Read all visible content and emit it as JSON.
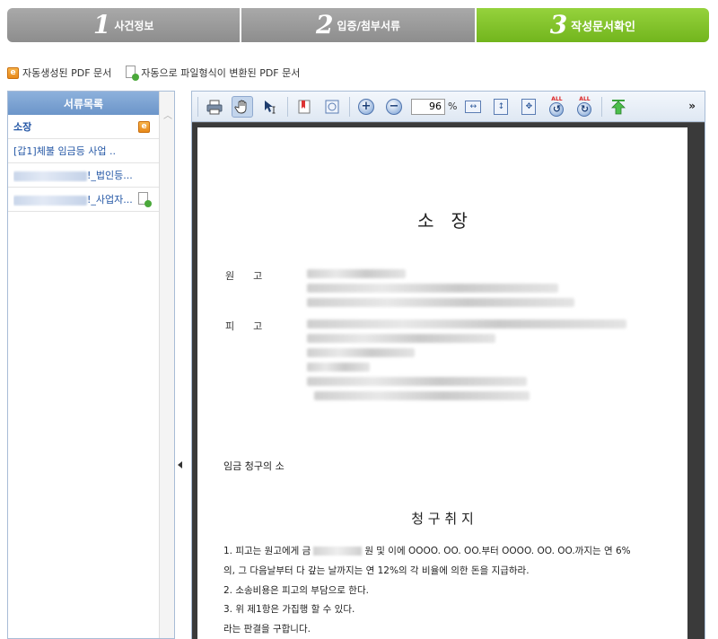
{
  "steps": [
    {
      "num": "1",
      "label": "사건정보"
    },
    {
      "num": "2",
      "label": "입증/첨부서류"
    },
    {
      "num": "3",
      "label": "작성문서확인"
    }
  ],
  "legend": {
    "auto_label": "자동생성된 PDF 문서",
    "converted_label": "자동으로 파일형식이 변환된 PDF 문서"
  },
  "doc_list": {
    "header": "서류목록",
    "items": [
      {
        "label": "소장",
        "icon": "auto-pdf-icon",
        "active": true
      },
      {
        "label": "[갑1]체불 임금등 사업 ..",
        "icon": null
      },
      {
        "label": "!_법인등...",
        "icon": null,
        "blurred_prefix": true
      },
      {
        "label": "!_사업자...",
        "icon": "converted-pdf-icon",
        "blurred_prefix": true
      }
    ]
  },
  "toolbar": {
    "zoom_value": "96",
    "zoom_unit": "%",
    "more_label": "»",
    "all_label": "ALL"
  },
  "document": {
    "title": "소   장",
    "plaintiff_label": "원      고",
    "defendant_label": "피      고",
    "case_name": "임금 청구의 소",
    "claim_title": "청 구 취 지",
    "claim_lines": [
      {
        "pre": "1. 피고는 원고에게 금",
        "post": "원 및 이에 OOOO. OO. OO.부터 OOOO. OO. OO.까지는 연 6%"
      },
      {
        "text": "의, 그 다음날부터 다 갚는 날까지는 연 12%의 각 비율에 의한 돈을 지급하라."
      },
      {
        "text": "2. 소송비용은 피고의 부담으로 한다."
      },
      {
        "text": "3. 위 제1항은 가집행 할 수 있다."
      },
      {
        "text": "라는 판결을 구합니다."
      }
    ]
  },
  "colors": {
    "step_active": "#7cc22a",
    "step_inactive": "#999999",
    "list_header": "#7aa0d2",
    "link": "#2356a5"
  }
}
